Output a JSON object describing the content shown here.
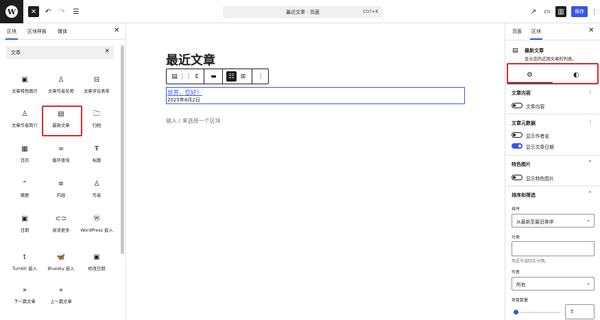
{
  "topbar": {
    "logo": "W",
    "document_title": "最近文章 · 页面",
    "shortcut": "Ctrl+K",
    "save_label": "保存"
  },
  "inserter": {
    "tabs": [
      "区块",
      "区块样板",
      "媒体"
    ],
    "search_value": "文章",
    "blocks": [
      {
        "label": "文章特色图片",
        "icon": "post-featured-image-icon"
      },
      {
        "label": "文章作者名称",
        "icon": "post-author-name-icon"
      },
      {
        "label": "文章评论表单",
        "icon": "post-comments-form-icon"
      },
      {
        "label": "文章作者简介",
        "icon": "post-author-biography-icon"
      },
      {
        "label": "最新文章",
        "icon": "latest-posts-icon"
      },
      {
        "label": "归档",
        "icon": "archives-icon"
      },
      {
        "label": "日历",
        "icon": "calendar-icon"
      },
      {
        "label": "循环查询",
        "icon": "query-loop-icon"
      },
      {
        "label": "标题",
        "icon": "post-title-icon"
      },
      {
        "label": "摘要",
        "icon": "excerpt-icon"
      },
      {
        "label": "内容",
        "icon": "content-icon"
      },
      {
        "label": "作者",
        "icon": "author-icon"
      },
      {
        "label": "日期",
        "icon": "date-icon"
      },
      {
        "label": "阅读更多",
        "icon": "read-more-icon"
      },
      {
        "label": "WordPress 嵌入",
        "icon": "wordpress-embed-icon"
      },
      {
        "label": "Tumblr 嵌入",
        "icon": "tumblr-embed-icon"
      },
      {
        "label": "Bluesky 嵌入",
        "icon": "bluesky-embed-icon"
      },
      {
        "label": "修改日期",
        "icon": "modified-date-icon"
      },
      {
        "label": "下一篇文章",
        "icon": "next-post-icon"
      },
      {
        "label": "上一篇文章",
        "icon": "previous-post-icon"
      }
    ]
  },
  "canvas": {
    "title": "最近文章",
    "post_link": "世界，您好！",
    "post_date": "2025年8月2日",
    "placeholder": "输入 / 来选择一个区块"
  },
  "sidebar": {
    "tabs": [
      "页面",
      "区块"
    ],
    "block_title": "最新文章",
    "block_description": "显示您的近期文章的列表。",
    "sections": {
      "post_content": {
        "title": "文章内容",
        "toggle_label": "文章内容",
        "toggle_on": false
      },
      "post_meta": {
        "title": "文章元数据",
        "author_label": "显示作者名",
        "author_on": false,
        "date_label": "显示文章日期",
        "date_on": true
      },
      "featured_image": {
        "title": "特色图片",
        "toggle_label": "显示特色图片",
        "toggle_on": false
      },
      "sorting": {
        "title": "排序和筛选",
        "order_label": "排序",
        "order_value": "从最新至最旧排序",
        "category_label": "分类",
        "category_help": "用逗号或回车分隔。",
        "author_label": "作者",
        "author_value": "所有",
        "count_label": "项目数量",
        "count_value": "5",
        "count_min": 1,
        "count_max": 100
      }
    }
  },
  "colors": {
    "accent": "#3858e9",
    "highlight": "#e0262c",
    "dark": "#1e1e1e"
  }
}
